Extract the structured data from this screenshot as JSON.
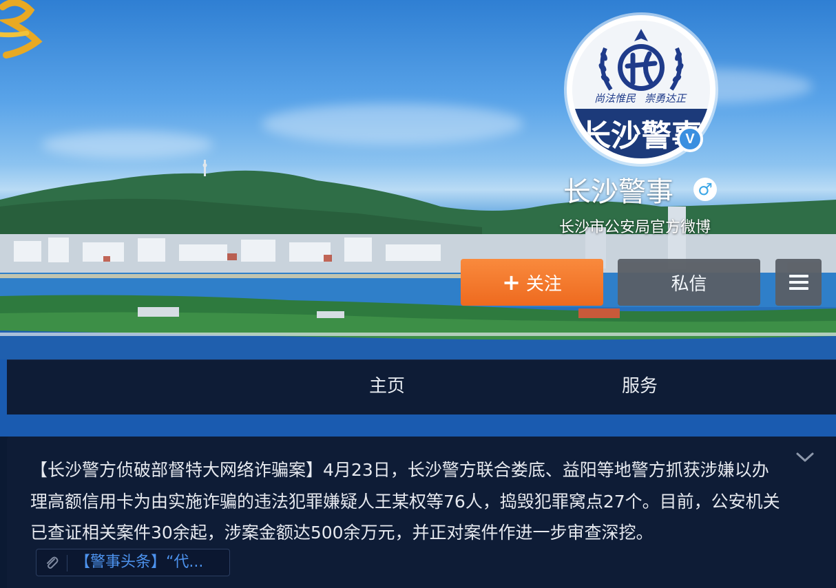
{
  "profile": {
    "name": "长沙警事",
    "description": "长沙市公安局官方微博",
    "verified_badge": "V",
    "gender_icon": "♂",
    "avatar": {
      "motto_left": "尚法惟民",
      "motto_right": "崇勇达正",
      "banner_text": "长沙警事"
    }
  },
  "actions": {
    "follow_plus": "+",
    "follow_label": "关注",
    "message_label": "私信",
    "menu_icon": "hamburger-icon"
  },
  "tabs": [
    {
      "label": "主页"
    },
    {
      "label": "服务"
    }
  ],
  "post": {
    "body": "【长沙警方侦破部督特大网络诈骗案】4月23日，长沙警方联合娄底、益阳等地警方抓获涉嫌以办理高额信用卡为由实施诈骗的违法犯罪嫌疑人王某权等76人，捣毁犯罪窝点27个。目前，公安机关已查证相关案件30余起，涉案金额达500余万元，并正对案件作进一步审查深挖。",
    "link_text": "【警事头条】“代...",
    "expand_icon": "chevron-down-icon"
  },
  "colors": {
    "follow_button": "#f07428",
    "secondary_button": "#5a5f66",
    "panel_bg": "#0e1c36",
    "link": "#4d93ee",
    "verified": "#3a8fe0",
    "gender": "#3aa6e6"
  }
}
